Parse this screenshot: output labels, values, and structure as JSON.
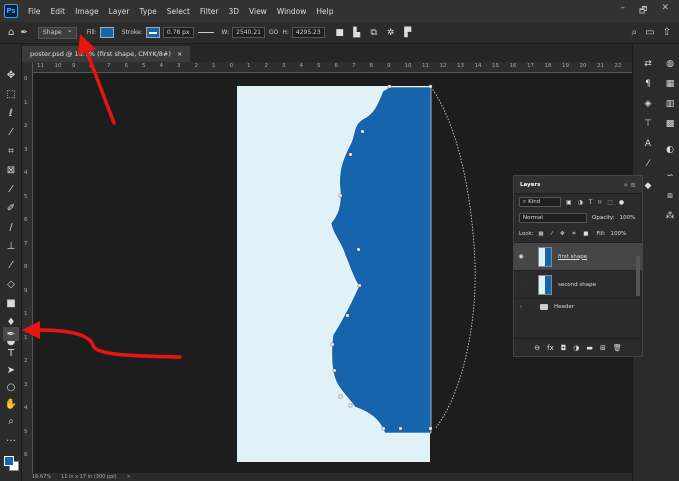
{
  "menubar": {
    "logo": "Ps",
    "items": [
      "File",
      "Edit",
      "Image",
      "Layer",
      "Type",
      "Select",
      "Filter",
      "3D",
      "View",
      "Window",
      "Help"
    ],
    "win_controls": [
      "–",
      "🗗",
      "✕"
    ]
  },
  "options": {
    "tool_mode": "Shape",
    "fill_label": "Fill:",
    "stroke_label": "Stroke:",
    "stroke_width": "0.78 px",
    "w_label": "W:",
    "w_value": "2540.21",
    "go_label": "GO",
    "h_label": "H:",
    "h_value": "4295.23"
  },
  "document": {
    "tab_title": "poster.psd @ 16.7% (first shape, CMYK/8#)",
    "close": "×"
  },
  "ruler": {
    "h_ticks": [
      "11",
      "10",
      "9",
      "8",
      "7",
      "6",
      "5",
      "4",
      "3",
      "2",
      "1",
      "0",
      "1",
      "2",
      "3",
      "4",
      "5",
      "6",
      "7",
      "8",
      "9",
      "10",
      "11",
      "12",
      "13",
      "14",
      "15",
      "16",
      "17",
      "18",
      "19",
      "20",
      "21",
      "22"
    ],
    "v_ticks": [
      "0",
      "1",
      "2",
      "3",
      "4",
      "5",
      "6",
      "7",
      "8",
      "9",
      "1",
      "1",
      "2",
      "3",
      "4",
      "5",
      "6"
    ]
  },
  "status": {
    "zoom": "16.67%",
    "size": "11 in x 17 in (300 ppi)",
    "arrow": ">"
  },
  "layers_panel": {
    "title": "Layers",
    "filter_kind": "Kind",
    "blend_mode": "Normal",
    "opacity_label": "Opacity:",
    "opacity_value": "100%",
    "lock_label": "Lock:",
    "fill_label": "Fill:",
    "fill_value": "100%",
    "layers": [
      {
        "name": "first shape",
        "selected": true
      },
      {
        "name": "second shape",
        "selected": false
      }
    ],
    "group_name": "Header"
  },
  "colors": {
    "shape_fill": "#1664ab",
    "artboard": "#e0f1f8",
    "annotation": "#e8140f"
  }
}
